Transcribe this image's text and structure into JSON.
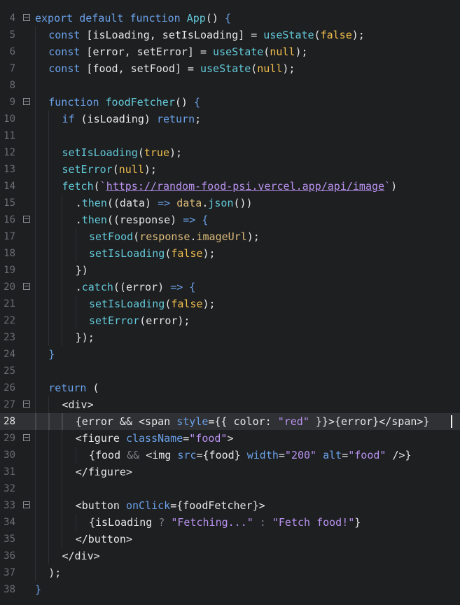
{
  "editor": {
    "active_line": 28,
    "lines": [
      {
        "n": "4",
        "fold": true,
        "indent": 0,
        "tokens": [
          [
            "kw",
            "export"
          ],
          [
            "pl",
            " "
          ],
          [
            "kw",
            "default"
          ],
          [
            "pl",
            " "
          ],
          [
            "kw",
            "function"
          ],
          [
            "pl",
            " "
          ],
          [
            "fn",
            "App"
          ],
          [
            "pl",
            "() "
          ],
          [
            "kw",
            "{"
          ]
        ]
      },
      {
        "n": "5",
        "fold": false,
        "indent": 1,
        "tokens": [
          [
            "kw",
            "const"
          ],
          [
            "pl",
            " [isLoading, setIsLoading] = "
          ],
          [
            "fn",
            "useState"
          ],
          [
            "pl",
            "("
          ],
          [
            "bool",
            "false"
          ],
          [
            "pl",
            ");"
          ]
        ]
      },
      {
        "n": "6",
        "fold": false,
        "indent": 1,
        "tokens": [
          [
            "kw",
            "const"
          ],
          [
            "pl",
            " [error, setError] = "
          ],
          [
            "fn",
            "useState"
          ],
          [
            "pl",
            "("
          ],
          [
            "bool",
            "null"
          ],
          [
            "pl",
            ");"
          ]
        ]
      },
      {
        "n": "7",
        "fold": false,
        "indent": 1,
        "tokens": [
          [
            "kw",
            "const"
          ],
          [
            "pl",
            " [food, setFood] = "
          ],
          [
            "fn",
            "useState"
          ],
          [
            "pl",
            "("
          ],
          [
            "bool",
            "null"
          ],
          [
            "pl",
            ");"
          ]
        ]
      },
      {
        "n": "8",
        "fold": false,
        "indent": 1,
        "tokens": []
      },
      {
        "n": "9",
        "fold": true,
        "indent": 1,
        "tokens": [
          [
            "kw",
            "function"
          ],
          [
            "pl",
            " "
          ],
          [
            "fn",
            "foodFetcher"
          ],
          [
            "pl",
            "() "
          ],
          [
            "kw",
            "{"
          ]
        ]
      },
      {
        "n": "10",
        "fold": false,
        "indent": 2,
        "tokens": [
          [
            "kw",
            "if"
          ],
          [
            "pl",
            " (isLoading) "
          ],
          [
            "kw",
            "return"
          ],
          [
            "pl",
            ";"
          ]
        ]
      },
      {
        "n": "11",
        "fold": false,
        "indent": 2,
        "tokens": []
      },
      {
        "n": "12",
        "fold": false,
        "indent": 2,
        "tokens": [
          [
            "fn",
            "setIsLoading"
          ],
          [
            "pl",
            "("
          ],
          [
            "bool",
            "true"
          ],
          [
            "pl",
            ");"
          ]
        ]
      },
      {
        "n": "13",
        "fold": false,
        "indent": 2,
        "tokens": [
          [
            "fn",
            "setError"
          ],
          [
            "pl",
            "("
          ],
          [
            "bool",
            "null"
          ],
          [
            "pl",
            ");"
          ]
        ]
      },
      {
        "n": "14",
        "fold": false,
        "indent": 2,
        "tokens": [
          [
            "fn",
            "fetch"
          ],
          [
            "pl",
            "("
          ],
          [
            "str",
            "`"
          ],
          [
            "url",
            "https://random-food-psi.vercel.app/api/image"
          ],
          [
            "str",
            "`"
          ],
          [
            "pl",
            ")"
          ]
        ]
      },
      {
        "n": "15",
        "fold": false,
        "indent": 3,
        "tokens": [
          [
            "pl",
            "."
          ],
          [
            "fn",
            "then"
          ],
          [
            "pl",
            "((data) "
          ],
          [
            "kw",
            "=>"
          ],
          [
            "pl",
            " "
          ],
          [
            "prop",
            "data"
          ],
          [
            "pl",
            "."
          ],
          [
            "fn",
            "json"
          ],
          [
            "pl",
            "())"
          ]
        ]
      },
      {
        "n": "16",
        "fold": true,
        "indent": 3,
        "tokens": [
          [
            "pl",
            "."
          ],
          [
            "fn",
            "then"
          ],
          [
            "pl",
            "((response) "
          ],
          [
            "kw",
            "=>"
          ],
          [
            "pl",
            " "
          ],
          [
            "kw",
            "{"
          ]
        ]
      },
      {
        "n": "17",
        "fold": false,
        "indent": 4,
        "tokens": [
          [
            "fn",
            "setFood"
          ],
          [
            "pl",
            "("
          ],
          [
            "prop",
            "response"
          ],
          [
            "pl",
            "."
          ],
          [
            "prop",
            "imageUrl"
          ],
          [
            "pl",
            ");"
          ]
        ]
      },
      {
        "n": "18",
        "fold": false,
        "indent": 4,
        "tokens": [
          [
            "fn",
            "setIsLoading"
          ],
          [
            "pl",
            "("
          ],
          [
            "bool",
            "false"
          ],
          [
            "pl",
            ");"
          ]
        ]
      },
      {
        "n": "19",
        "fold": false,
        "indent": 3,
        "tokens": [
          [
            "pl",
            "})"
          ]
        ]
      },
      {
        "n": "20",
        "fold": true,
        "indent": 3,
        "tokens": [
          [
            "pl",
            "."
          ],
          [
            "fn",
            "catch"
          ],
          [
            "pl",
            "((error) "
          ],
          [
            "kw",
            "=>"
          ],
          [
            "pl",
            " "
          ],
          [
            "kw",
            "{"
          ]
        ]
      },
      {
        "n": "21",
        "fold": false,
        "indent": 4,
        "tokens": [
          [
            "fn",
            "setIsLoading"
          ],
          [
            "pl",
            "("
          ],
          [
            "bool",
            "false"
          ],
          [
            "pl",
            ");"
          ]
        ]
      },
      {
        "n": "22",
        "fold": false,
        "indent": 4,
        "tokens": [
          [
            "fn",
            "setError"
          ],
          [
            "pl",
            "(error);"
          ]
        ]
      },
      {
        "n": "23",
        "fold": false,
        "indent": 3,
        "tokens": [
          [
            "pl",
            "});"
          ]
        ]
      },
      {
        "n": "24",
        "fold": false,
        "indent": 1,
        "tokens": [
          [
            "kw",
            "}"
          ]
        ]
      },
      {
        "n": "25",
        "fold": false,
        "indent": 1,
        "tokens": []
      },
      {
        "n": "26",
        "fold": false,
        "indent": 1,
        "tokens": [
          [
            "kw",
            "return"
          ],
          [
            "pl",
            " ("
          ]
        ]
      },
      {
        "n": "27",
        "fold": true,
        "indent": 2,
        "tokens": [
          [
            "pl",
            "<div>"
          ]
        ]
      },
      {
        "n": "28",
        "fold": false,
        "indent": 3,
        "tokens": [
          [
            "pl",
            "{error && <span "
          ],
          [
            "attr",
            "style"
          ],
          [
            "pl",
            "={{ color: "
          ],
          [
            "str",
            "\"red\""
          ],
          [
            "pl",
            " }}>{error}</span>}"
          ]
        ]
      },
      {
        "n": "29",
        "fold": true,
        "indent": 3,
        "tokens": [
          [
            "pl",
            "<figure "
          ],
          [
            "attr",
            "className"
          ],
          [
            "pl",
            "="
          ],
          [
            "str",
            "\"food\""
          ],
          [
            "pl",
            ">"
          ]
        ]
      },
      {
        "n": "30",
        "fold": false,
        "indent": 4,
        "tokens": [
          [
            "pl",
            "{food "
          ],
          [
            "op",
            "&&"
          ],
          [
            "pl",
            " <img "
          ],
          [
            "attr",
            "src"
          ],
          [
            "pl",
            "={food} "
          ],
          [
            "attr",
            "width"
          ],
          [
            "pl",
            "="
          ],
          [
            "str",
            "\"200\""
          ],
          [
            "pl",
            " "
          ],
          [
            "attr",
            "alt"
          ],
          [
            "pl",
            "="
          ],
          [
            "str",
            "\"food\""
          ],
          [
            "pl",
            " />}"
          ]
        ]
      },
      {
        "n": "31",
        "fold": false,
        "indent": 3,
        "tokens": [
          [
            "pl",
            "</figure>"
          ]
        ]
      },
      {
        "n": "32",
        "fold": false,
        "indent": 3,
        "tokens": []
      },
      {
        "n": "33",
        "fold": true,
        "indent": 3,
        "tokens": [
          [
            "pl",
            "<button "
          ],
          [
            "attr",
            "onClick"
          ],
          [
            "pl",
            "={foodFetcher}>"
          ]
        ]
      },
      {
        "n": "34",
        "fold": false,
        "indent": 4,
        "tokens": [
          [
            "pl",
            "{isLoading "
          ],
          [
            "op",
            "?"
          ],
          [
            "pl",
            " "
          ],
          [
            "str",
            "\"Fetching...\""
          ],
          [
            "pl",
            " "
          ],
          [
            "op",
            ":"
          ],
          [
            "pl",
            " "
          ],
          [
            "str",
            "\"Fetch food!\""
          ],
          [
            "pl",
            "}"
          ]
        ]
      },
      {
        "n": "35",
        "fold": false,
        "indent": 3,
        "tokens": [
          [
            "pl",
            "</button>"
          ]
        ]
      },
      {
        "n": "36",
        "fold": false,
        "indent": 2,
        "tokens": [
          [
            "pl",
            "</div>"
          ]
        ]
      },
      {
        "n": "37",
        "fold": false,
        "indent": 1,
        "tokens": [
          [
            "pl",
            ");"
          ]
        ]
      },
      {
        "n": "38",
        "fold": false,
        "indent": 0,
        "tokens": [
          [
            "kw",
            "}"
          ]
        ]
      }
    ]
  }
}
